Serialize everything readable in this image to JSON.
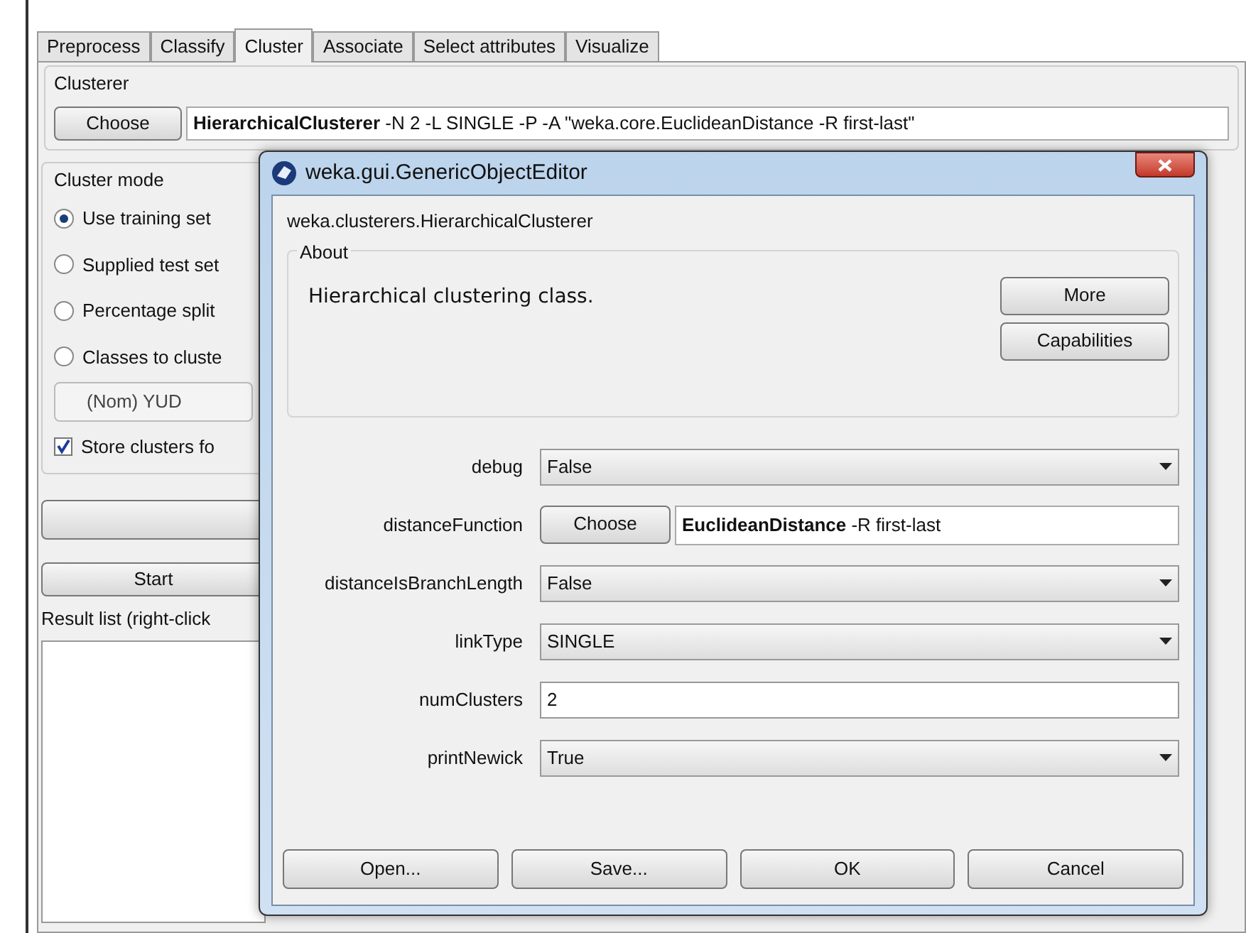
{
  "tabs": [
    {
      "label": "Preprocess",
      "selected": false
    },
    {
      "label": "Classify",
      "selected": false
    },
    {
      "label": "Cluster",
      "selected": true
    },
    {
      "label": "Associate",
      "selected": false
    },
    {
      "label": "Select attributes",
      "selected": false
    },
    {
      "label": "Visualize",
      "selected": false
    }
  ],
  "clusterer": {
    "title": "Clusterer",
    "button": "Choose",
    "value": "**HierarchicalClusterer** -N 2 -L SINGLE -P -A \"weka.core.EuclideanDistance -R first-last\""
  },
  "cluster_mode": {
    "title": "Cluster mode",
    "options": [
      {
        "label": "Use training set",
        "selected": true
      },
      {
        "label": "Supplied test set",
        "selected": false
      },
      {
        "label": "Percentage split",
        "selected": false
      },
      {
        "label": "Classes to cluste",
        "selected": false
      }
    ],
    "class_attribute": "(Nom) YUD",
    "store": {
      "label": "Store clusters fo",
      "checked": true
    }
  },
  "start_button": "Start",
  "result_list": {
    "title": "Result list (right-click"
  },
  "dialog": {
    "title": "weka.gui.GenericObjectEditor",
    "class_name": "weka.clusterers.HierarchicalClusterer",
    "about": {
      "title": "About",
      "text": "Hierarchical clustering class.",
      "buttons": [
        "More",
        "Capabilities"
      ]
    },
    "properties": [
      {
        "name": "debug",
        "kind": "dropdown",
        "value": "False"
      },
      {
        "name": "distanceFunction",
        "kind": "chooser",
        "button": "Choose",
        "value": "**EuclideanDistance** -R first-last"
      },
      {
        "name": "distanceIsBranchLength",
        "kind": "dropdown",
        "value": "False"
      },
      {
        "name": "linkType",
        "kind": "dropdown",
        "value": "SINGLE"
      },
      {
        "name": "numClusters",
        "kind": "text",
        "value": "2"
      },
      {
        "name": "printNewick",
        "kind": "dropdown",
        "value": "True"
      }
    ],
    "buttons": [
      "Open...",
      "Save...",
      "OK",
      "Cancel"
    ]
  }
}
